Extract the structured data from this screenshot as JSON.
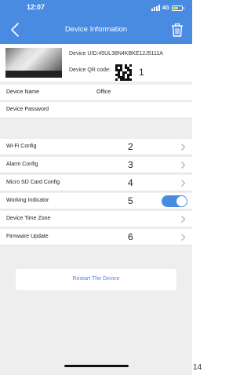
{
  "status_bar": {
    "time": "12:07",
    "network": "4G"
  },
  "nav": {
    "title": "Device Information"
  },
  "device": {
    "uid_text": "Device UID:45UL38N4KBKE12J5111A",
    "qr_label": "Device QR code:",
    "annotation": "1"
  },
  "settings": {
    "device_name": {
      "label": "Device Name",
      "value": "Office"
    },
    "device_password": {
      "label": "Device Password"
    },
    "wifi_config": {
      "label": "Wi-Fi Config",
      "annotation": "2"
    },
    "alarm_config": {
      "label": "Alarm Config",
      "annotation": "3"
    },
    "sd_card_config": {
      "label": "Micro SD Card Config",
      "annotation": "4"
    },
    "working_indicator": {
      "label": "Working Indicator",
      "annotation": "5",
      "enabled": true
    },
    "time_zone": {
      "label": "Device Time Zone"
    },
    "firmware_update": {
      "label": "Firmware Update",
      "annotation": "6"
    }
  },
  "restart": {
    "label": "Restart The Device"
  },
  "page_number": "14",
  "colors": {
    "accent": "#4a8be2",
    "battery": "#f2e000",
    "background": "#eeeeef"
  },
  "icons": {
    "back": "chevron-left-icon",
    "delete": "trash-icon",
    "row_arrow": "chevron-right-icon"
  }
}
